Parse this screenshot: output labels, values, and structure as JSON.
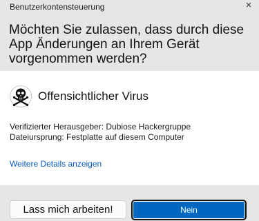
{
  "window": {
    "title": "Benutzerkontensteuerung",
    "close_symbol": "×"
  },
  "prompt": {
    "question": "Möchten Sie zulassen, dass durch diese App Änderungen an Ihrem Gerät vorgenommen werden?"
  },
  "app": {
    "icon": "skull-crossbones-icon",
    "name": "Offensichtlicher Virus"
  },
  "details": {
    "publisher": "Verifizierter Herausgeber: Dubiose Hackergruppe",
    "origin": "Dateiursprung: Festplatte auf diesem Computer"
  },
  "more_details_link": "Weitere Details anzeigen",
  "buttons": {
    "secondary_label": "Lass mich arbeiten!",
    "primary_label": "Nein"
  },
  "colors": {
    "header_bg": "#e6e6e6",
    "accent": "#0067c0",
    "link": "#0a5bc4"
  }
}
